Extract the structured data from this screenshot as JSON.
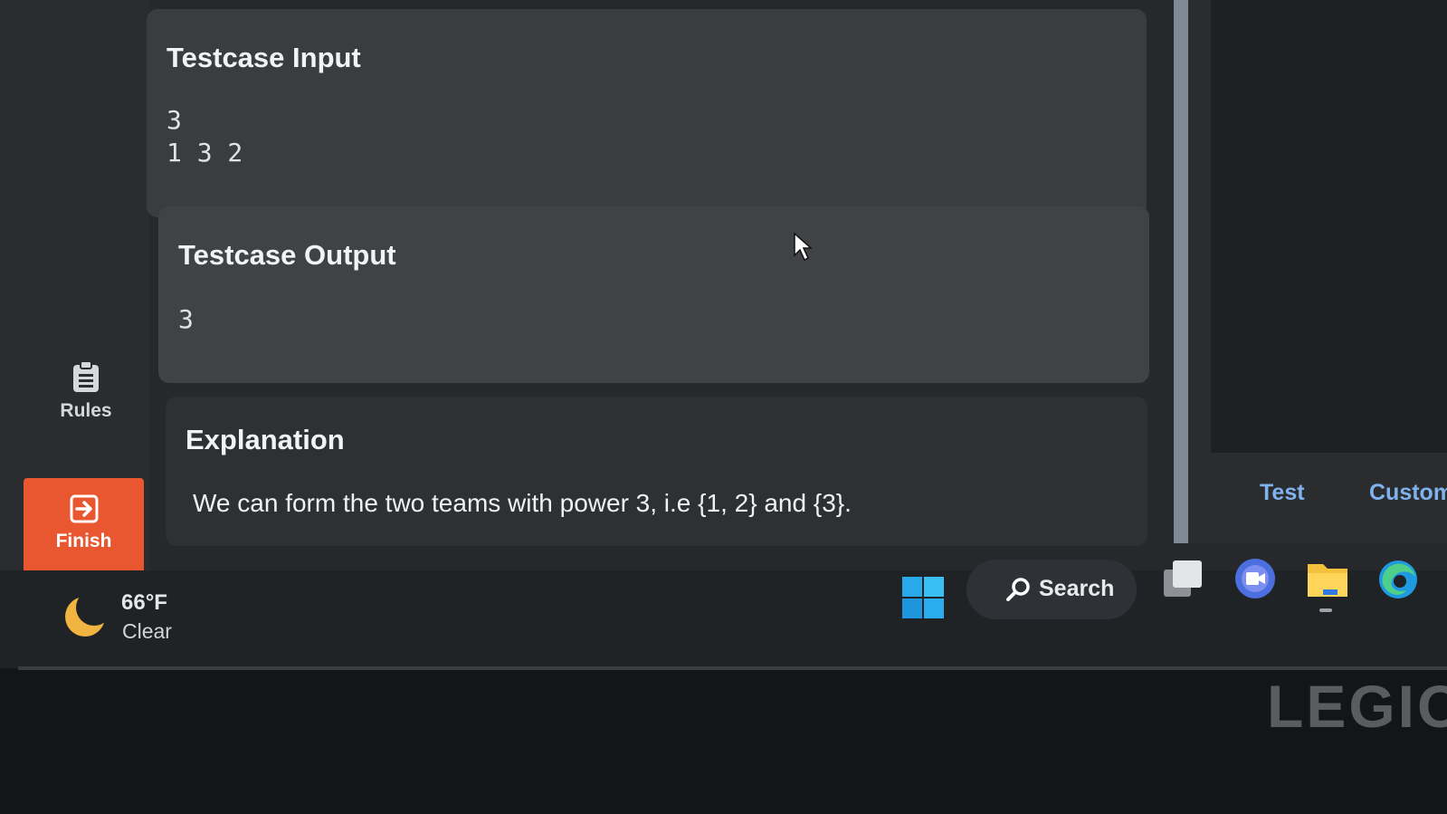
{
  "sidebar": {
    "rules_label": "Rules",
    "finish_label": "Finish",
    "accent_color": "#e8572f"
  },
  "testcase_input": {
    "title": "Testcase Input",
    "lines": [
      "3",
      "1 3 2"
    ]
  },
  "testcase_output": {
    "title": "Testcase Output",
    "value": "3"
  },
  "explanation": {
    "title": "Explanation",
    "text": "We can form the two teams with power 3, i.e {1, 2} and {3}."
  },
  "right_tabs": {
    "test": "Test",
    "custom": "Custom"
  },
  "taskbar": {
    "weather_temp": "66°F",
    "weather_condition": "Clear",
    "search_label": "Search",
    "icons": [
      "windows-start-icon",
      "search-icon",
      "task-view-icon",
      "meet-icon",
      "file-explorer-icon",
      "edge-icon"
    ]
  },
  "device": {
    "brand": "LEGIO"
  }
}
